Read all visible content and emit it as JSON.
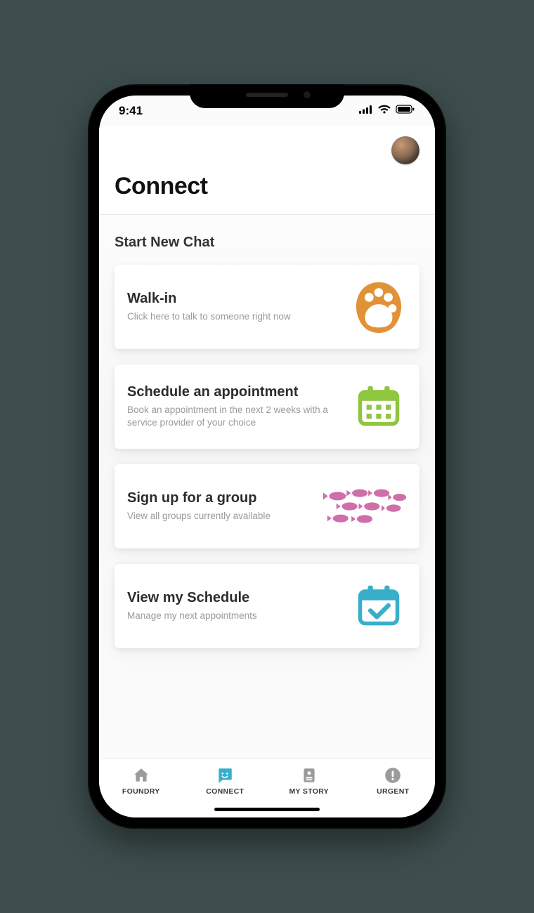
{
  "status": {
    "time": "9:41"
  },
  "header": {
    "title": "Connect"
  },
  "section": {
    "title": "Start New Chat"
  },
  "cards": [
    {
      "title": "Walk-in",
      "sub": "Click here to talk to someone right now"
    },
    {
      "title": "Schedule an appointment",
      "sub": "Book an appointment in the next 2 weeks with a service provider of your choice"
    },
    {
      "title": "Sign up for a group",
      "sub": "View all groups currently available"
    },
    {
      "title": "View my Schedule",
      "sub": "Manage my next appointments"
    }
  ],
  "tabs": [
    {
      "label": "FOUNDRY"
    },
    {
      "label": "CONNECT"
    },
    {
      "label": "MY STORY"
    },
    {
      "label": "URGENT"
    }
  ],
  "colors": {
    "accent": "#39aecb",
    "paw": "#e19237",
    "calendar_green": "#8fc63f",
    "fish": "#cf6fa9",
    "calendar_blue": "#39aecb"
  }
}
